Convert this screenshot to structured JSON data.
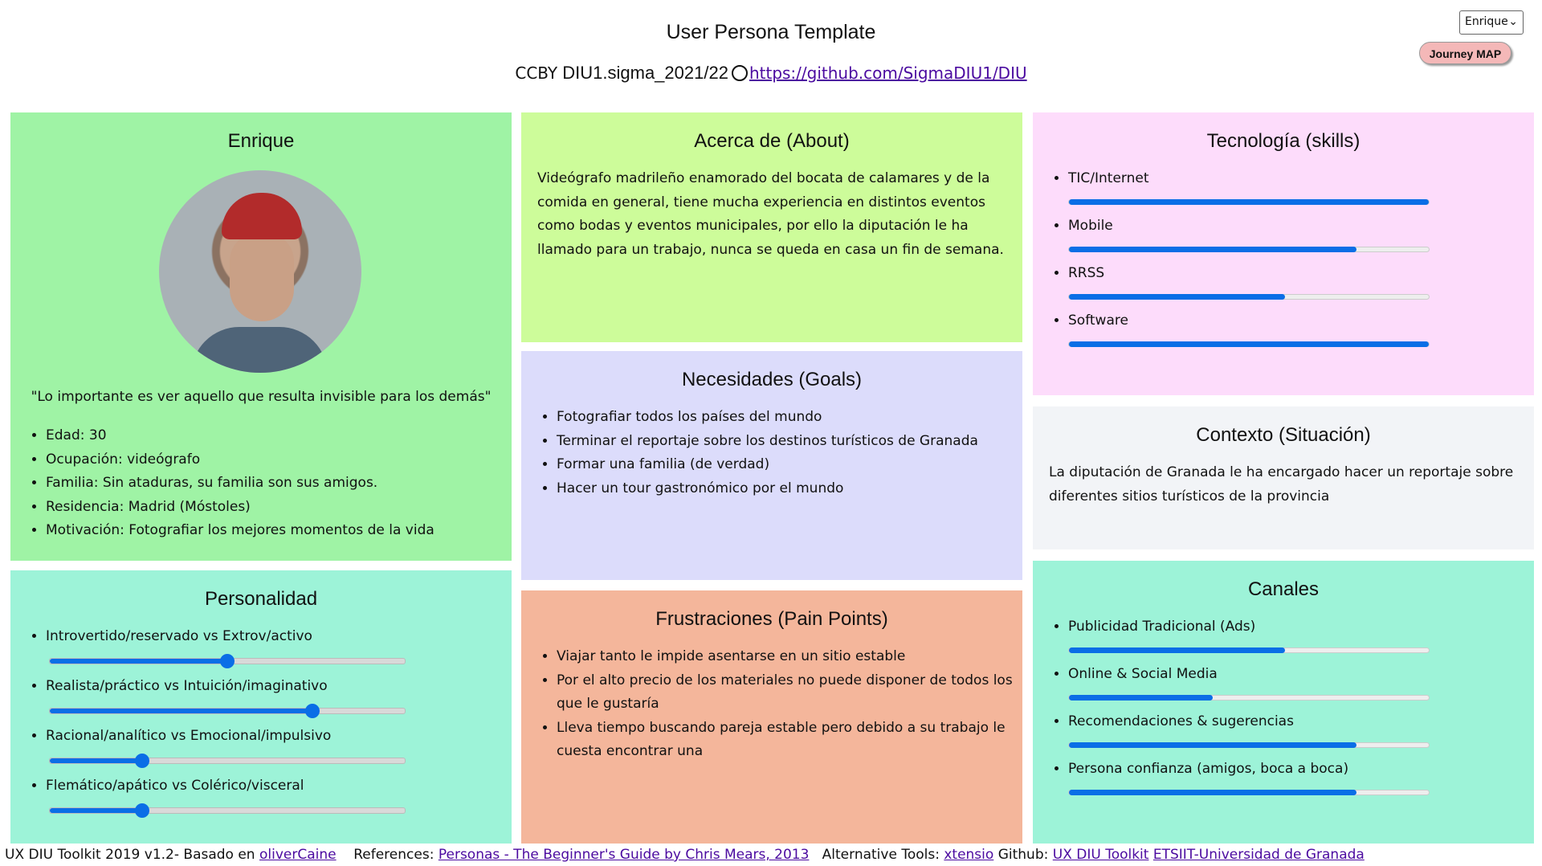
{
  "header": {
    "title": "User Persona Template",
    "license": "CCBY",
    "project": "DIU1.sigma_2021/22",
    "repo_link": "https://github.com/SigmaDIU1/DIU"
  },
  "controls": {
    "persona_select": "Enrique",
    "journey_button": "Journey MAP"
  },
  "profile": {
    "name": "Enrique",
    "quote": "\"Lo importante es ver aquello que resulta invisible para los demás\"",
    "details": [
      "Edad: 30",
      "Ocupación: videógrafo",
      "Familia: Sin ataduras, su familia son sus amigos.",
      "Residencia: Madrid (Móstoles)",
      "Motivación: Fotografiar los mejores momentos de la vida"
    ]
  },
  "about": {
    "title": "Acerca de (About)",
    "text": "Videógrafo madrileño enamorado del bocata de calamares y de la comida en general, tiene mucha experiencia en distintos eventos como bodas y eventos municipales, por ello la diputación le ha llamado para un trabajo, nunca se queda en casa un fin de semana."
  },
  "goals": {
    "title": "Necesidades (Goals)",
    "items": [
      "Fotografiar todos los países del mundo",
      "Terminar el reportaje sobre los destinos turísticos de Granada",
      "Formar una familia (de verdad)",
      "Hacer un tour gastronómico por el mundo"
    ]
  },
  "frustrations": {
    "title": "Frustraciones (Pain Points)",
    "items": [
      "Viajar tanto le impide asentarse en un sitio estable",
      "Por el alto precio de los materiales no puede disponer de todos los que le gustaría",
      "Lleva tiempo buscando pareja estable pero debido a su trabajo le cuesta encontrar una"
    ]
  },
  "personality": {
    "title": "Personalidad",
    "traits": [
      {
        "label": "Introvertido/reservado vs Extrov/activo",
        "value": 0.5
      },
      {
        "label": "Realista/práctico vs Intuición/imaginativo",
        "value": 0.74
      },
      {
        "label": "Racional/analítico vs Emocional/impulsivo",
        "value": 0.26
      },
      {
        "label": "Flemático/apático vs Colérico/visceral",
        "value": 0.26
      }
    ]
  },
  "skills": {
    "title": "Tecnología (skills)",
    "items": [
      {
        "label": "TIC/Internet",
        "value": 1.0
      },
      {
        "label": "Mobile",
        "value": 0.8
      },
      {
        "label": "RRSS",
        "value": 0.6
      },
      {
        "label": "Software",
        "value": 1.0
      }
    ]
  },
  "context": {
    "title": "Contexto (Situación)",
    "text": "La diputación de Granada le ha encargado hacer un reportaje sobre diferentes sitios turísticos de la provincia"
  },
  "channels": {
    "title": "Canales",
    "items": [
      {
        "label": "Publicidad Tradicional (Ads)",
        "value": 0.6
      },
      {
        "label": "Online & Social Media",
        "value": 0.4
      },
      {
        "label": "Recomendaciones & sugerencias",
        "value": 0.8
      },
      {
        "label": "Persona confianza (amigos, boca a boca)",
        "value": 0.8
      }
    ]
  },
  "footer": {
    "toolkit": "UX DIU Toolkit 2019 v1.2- Basado en",
    "based_link": "oliverCaine",
    "references_label": "References:",
    "references_link": "Personas - The Beginner's Guide by Chris Mears, 2013",
    "alt_label": "Alternative Tools:",
    "alt_link": "xtensio",
    "github_label": "Github:",
    "github_link": "UX DIU Toolkit",
    "univ_link": "ETSIIT-Universidad de Granada"
  },
  "colors": {
    "profile_bg": "#9ff3a5",
    "about_bg": "#cdfc9a",
    "goals_bg": "#dcdcfb",
    "frustrations_bg": "#f4b69b",
    "personality_bg": "#9df3d8",
    "skills_bg": "#fddcfb",
    "context_bg": "#f2f4f7",
    "channels_bg": "#9df3d8",
    "bar_blue": "#0a6ee6"
  }
}
